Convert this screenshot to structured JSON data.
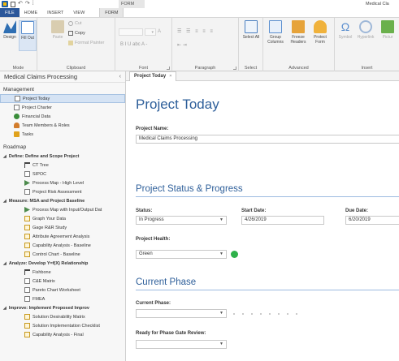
{
  "titlebar": {
    "context_tab_title": "FORM",
    "app_title": "Medical Cla"
  },
  "ribbon_tabs": [
    "FILE",
    "HOME",
    "INSERT",
    "VIEW",
    "FORM"
  ],
  "ribbon": {
    "mode": {
      "label": "Mode",
      "design": "Design",
      "fill_out": "Fill Out"
    },
    "clipboard": {
      "label": "Clipboard",
      "paste": "Paste",
      "cut": "Cut",
      "copy": "Copy",
      "format_painter": "Format Painter"
    },
    "font": {
      "label": "Font",
      "row2": "B  I  U  abc  A  -"
    },
    "paragraph": {
      "label": "Paragraph"
    },
    "select": {
      "label": "Select",
      "select_all": "Select All"
    },
    "advanced": {
      "label": "Advanced",
      "group_columns": "Group Columns",
      "freeze_headers": "Freeze Headers",
      "protect_form": "Protect Form"
    },
    "insert": {
      "label": "Insert",
      "symbol": "Symbol",
      "hyperlink": "Hyperlink",
      "picture": "Pictur"
    }
  },
  "nav": {
    "title": "Medical Claims Processing",
    "collapse": "‹",
    "management_label": "Management",
    "management_items": [
      "Project Today",
      "Project Charter",
      "Financial Data",
      "Team Members & Roles",
      "Tasks"
    ],
    "roadmap_label": "Roadmap",
    "groups": [
      {
        "title": "Define:  Define and Scope Project",
        "items": [
          "CT Tree",
          "SIPOC",
          "Process Map - High Level",
          "Project Risk Assessment"
        ]
      },
      {
        "title": "Measure:  MSA and Project Baseline",
        "items": [
          "Process Map with Input/Output Dat",
          "Graph Your Data",
          "Gage R&R Study",
          "Attribute Agreement Analysis",
          "Capability Analysis - Baseline",
          "Control Chart - Baseline"
        ]
      },
      {
        "title": "Analyze:  Develop Y=f(X) Relationship",
        "items": [
          "Fishbone",
          "C&E Matrix",
          "Pareto Chart Worksheet",
          "FMEA"
        ]
      },
      {
        "title": "Improve:  Implement Proposed Improv",
        "items": [
          "Solution Desirability Matrix",
          "Solution Implementation Checklist",
          "Capability Analysis - Final"
        ]
      }
    ]
  },
  "doc_tab": {
    "label": "Project Today",
    "close": "×"
  },
  "form": {
    "title": "Project Today",
    "project_name_label": "Project Name:",
    "project_name_value": "Medical Claims Processing",
    "status_section": "Project Status & Progress",
    "status_label": "Status:",
    "status_value": "In Progress",
    "start_label": "Start Date:",
    "start_value": "4/26/2019",
    "due_label": "Due Date:",
    "due_value": "6/20/2019",
    "health_label": "Project Health:",
    "health_value": "Green",
    "phase_section": "Current Phase",
    "current_phase_label": "Current Phase:",
    "current_phase_value": "",
    "gate_label": "Ready for Phase Gate Review:",
    "gate_value": ""
  },
  "colors": {
    "accent": "#2e5f9a",
    "file_tab": "#2b579a",
    "health_green": "#2eb14a"
  }
}
